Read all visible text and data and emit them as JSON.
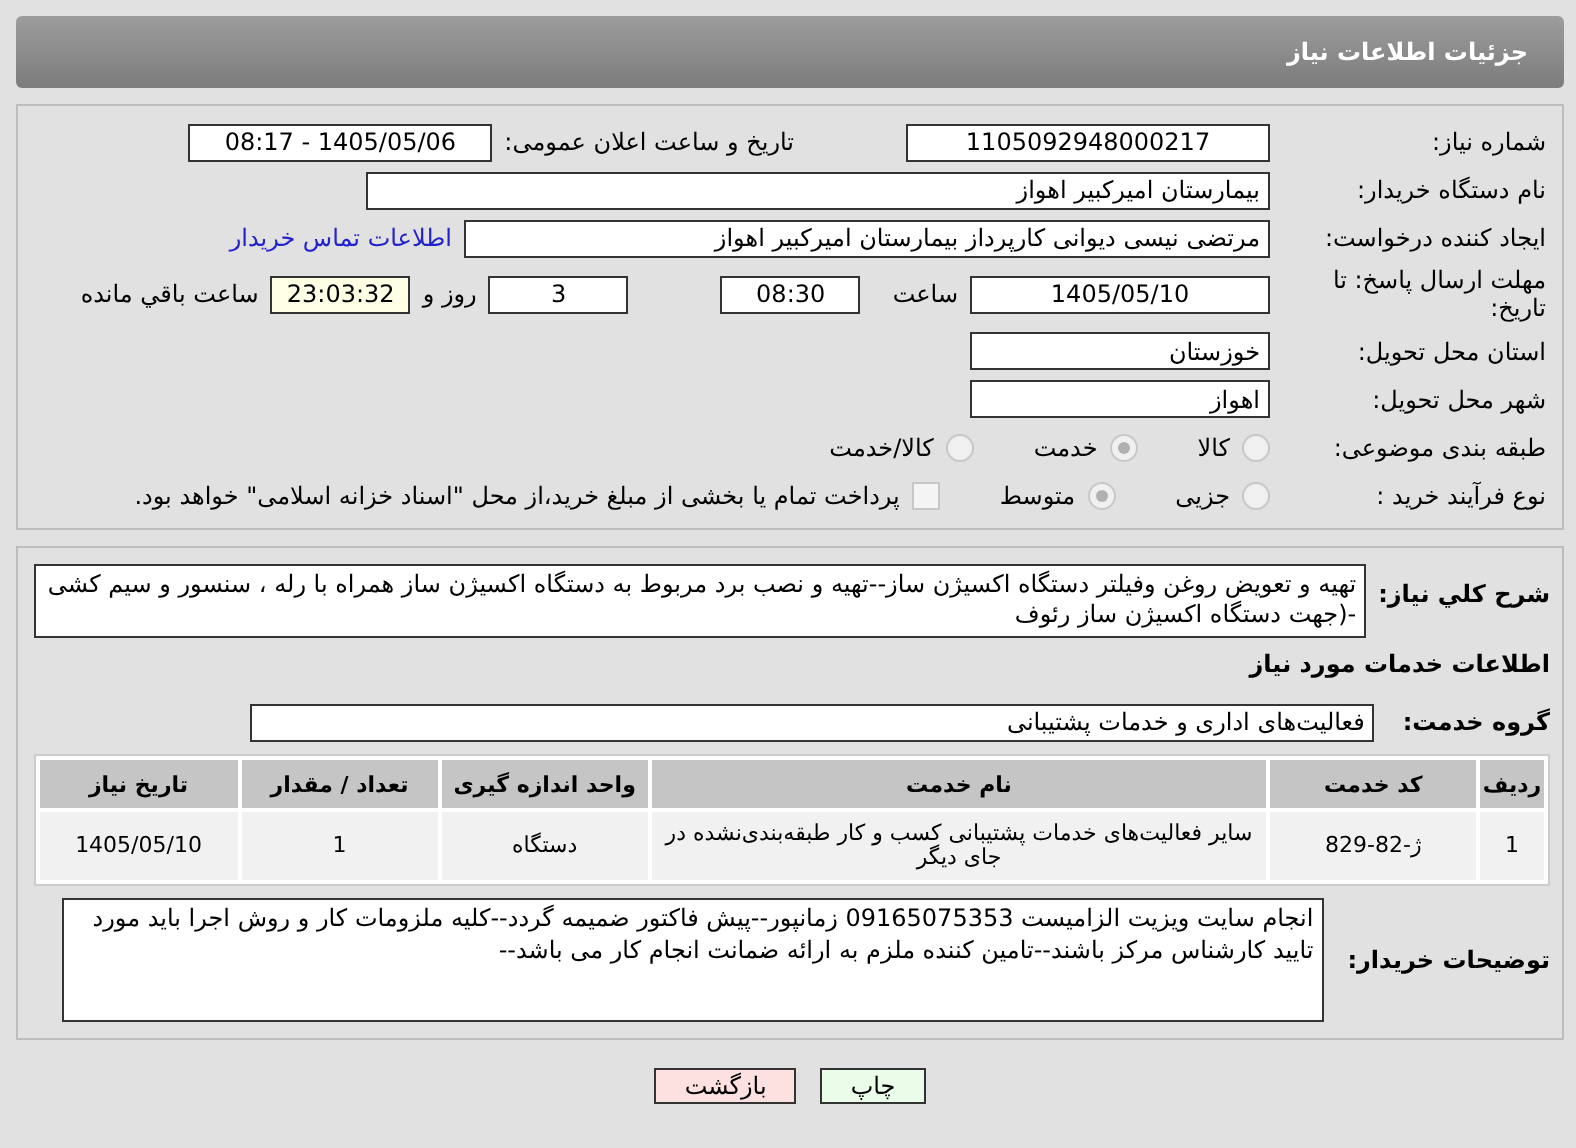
{
  "header": {
    "title": "جزئیات اطلاعات نیاز"
  },
  "details": {
    "need_number": {
      "label": "شماره نیاز:",
      "value": "1105092948000217"
    },
    "announce": {
      "label": "تاریخ و ساعت اعلان عمومی:",
      "value": "1405/05/06 - 08:17"
    },
    "buyer_org": {
      "label": "نام دستگاه خریدار:",
      "value": "بیمارستان امیرکبیر اهواز"
    },
    "creator": {
      "label": "ایجاد کننده درخواست:",
      "value": "مرتضی نیسی دیوانی کارپرداز بیمارستان امیرکبیر اهواز",
      "link": "اطلاعات تماس خریدار"
    },
    "deadline": {
      "label": "مهلت ارسال پاسخ: تا تاریخ:",
      "date": "1405/05/10",
      "time_label": "ساعت",
      "time": "08:30",
      "days": "3",
      "days_label": "روز و",
      "remaining": "23:03:32",
      "remaining_label": "ساعت باقي مانده"
    },
    "province": {
      "label": "استان محل تحویل:",
      "value": "خوزستان"
    },
    "city": {
      "label": "شهر محل تحویل:",
      "value": "اهواز"
    },
    "category": {
      "label": "طبقه بندی موضوعی:",
      "options": [
        {
          "label": "کالا",
          "selected": false
        },
        {
          "label": "خدمت",
          "selected": true
        },
        {
          "label": "کالا/خدمت",
          "selected": false
        }
      ]
    },
    "process": {
      "label": "نوع فرآیند خرید :",
      "options": [
        {
          "label": "جزیی",
          "selected": false
        },
        {
          "label": "متوسط",
          "selected": true
        }
      ],
      "treasury": {
        "checked": false,
        "text": "پرداخت تمام یا بخشی از مبلغ خرید،از محل \"اسناد خزانه اسلامی\" خواهد بود."
      }
    }
  },
  "need": {
    "label": "شرح کلي نیاز:",
    "value": "تهیه و تعویض روغن وفیلتر دستگاه اکسیژن ساز--تهیه و نصب برد مربوط به دستگاه اکسیژن ساز همراه با رله ، سنسور و سیم کشی -(جهت دستگاه اکسیژن ساز رئوف",
    "services_title": "اطلاعات خدمات مورد نیاز",
    "group": {
      "label": "گروه خدمت:",
      "value": "فعالیت‌های اداری و خدمات پشتیبانی"
    },
    "table": {
      "columns": [
        "ردیف",
        "کد خدمت",
        "نام خدمت",
        "واحد اندازه گیری",
        "تعداد / مقدار",
        "تاریخ نیاز"
      ],
      "rows": [
        [
          "1",
          "ژ-82-829",
          "سایر فعالیت‌های خدمات پشتیبانی کسب و کار طبقه‌بندی‌نشده در جای دیگر",
          "دستگاه",
          "1",
          "1405/05/10"
        ]
      ]
    },
    "notes": {
      "label": "توضیحات خریدار:",
      "value": "انجام سایت ویزیت الزامیست 09165075353 زمانپور--پیش فاکتور ضمیمه گردد--کلیه ملزومات کار و روش اجرا باید مورد تایید کارشناس مرکز باشند--تامین کننده ملزم به ارائه ضمانت انجام کار می باشد--"
    }
  },
  "buttons": [
    {
      "label": "چاپ",
      "kind": "print"
    },
    {
      "label": "بازگشت",
      "kind": "back"
    }
  ]
}
